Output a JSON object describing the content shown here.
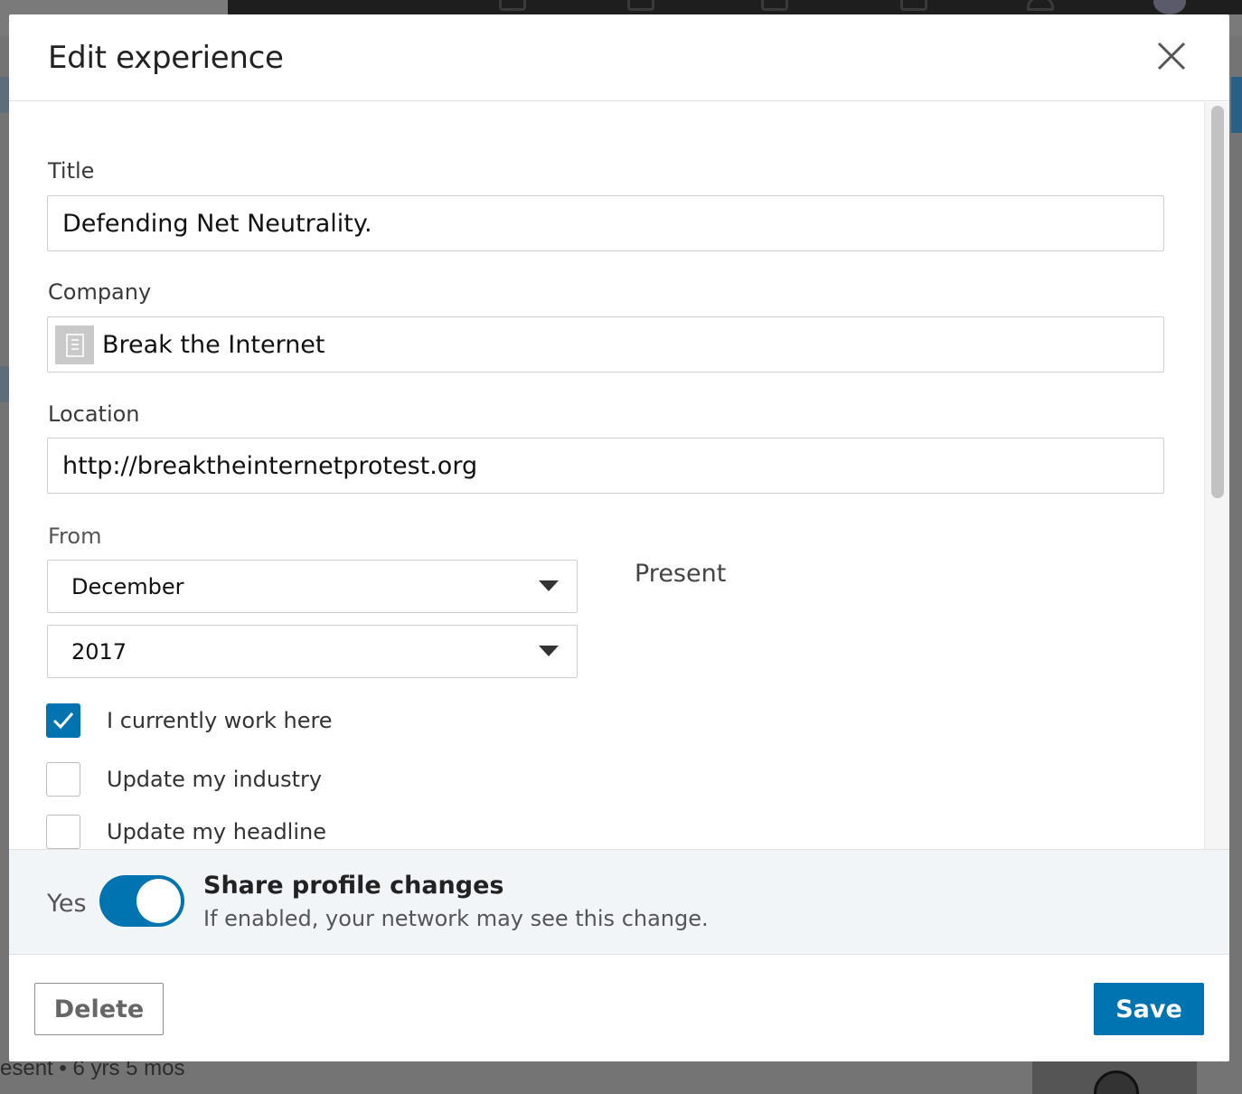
{
  "background": {
    "bottom_text": "esent  • 6 yrs 5 mos"
  },
  "modal": {
    "title": "Edit experience",
    "fields": {
      "title": {
        "label": "Title",
        "value": "Defending Net Neutrality."
      },
      "company": {
        "label": "Company",
        "value": "Break the Internet"
      },
      "location": {
        "label": "Location",
        "value": "http://breaktheinternetprotest.org"
      }
    },
    "dates": {
      "from_label": "From",
      "from_month": "December",
      "from_year": "2017",
      "to_value": "Present"
    },
    "checkboxes": [
      {
        "label": "I currently work here",
        "checked": true
      },
      {
        "label": "Update my industry",
        "checked": false
      },
      {
        "label": "Update my headline",
        "checked": false
      }
    ],
    "share": {
      "toggle_label": "Yes",
      "toggle_on": true,
      "title": "Share profile changes",
      "subtitle": "If enabled, your network may see this change."
    },
    "footer": {
      "delete_label": "Delete",
      "save_label": "Save"
    }
  },
  "colors": {
    "primary": "#0073b1",
    "share_bg": "#f2f5f8"
  }
}
